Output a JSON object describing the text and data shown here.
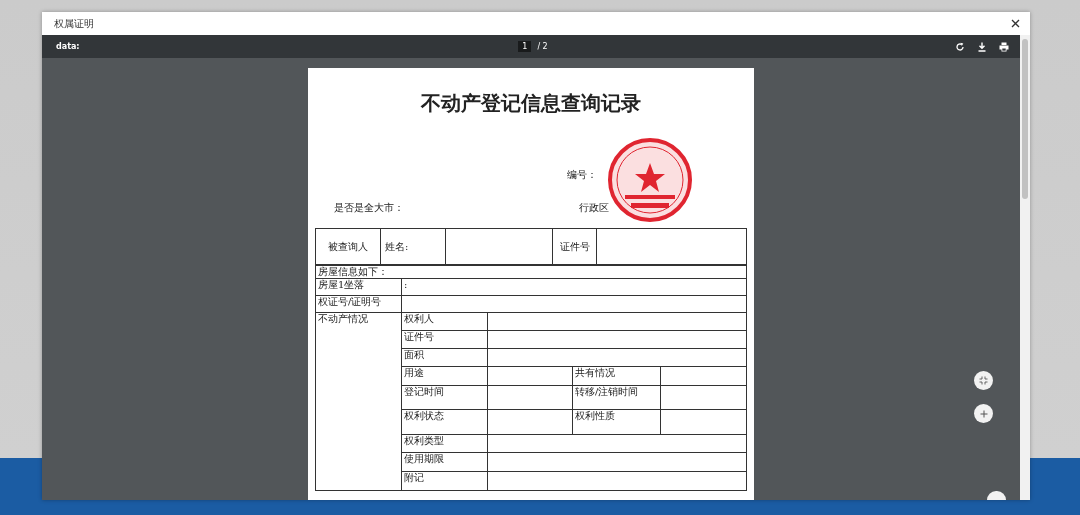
{
  "dialog": {
    "title": "权属证明"
  },
  "viewer_toolbar": {
    "file_name": "data:",
    "page": "1",
    "page_total": "/ 2"
  },
  "document": {
    "title": "不动产登记信息查询记录",
    "number_label": "编号：",
    "city_label": "是否是全大市：",
    "region_label": "行政区",
    "queried": {
      "label": "被查询人",
      "name_label": "姓名:",
      "id_label": "证件号"
    },
    "section_heading": "房屋信息如下：",
    "info_rows": [
      {
        "label": "房屋1坐落",
        "value": ":"
      },
      {
        "label": "权证号/证明号"
      }
    ],
    "property": {
      "label": "不动产情况",
      "rows": [
        {
          "kind": "single",
          "label": "权利人"
        },
        {
          "kind": "single",
          "label": "证件号"
        },
        {
          "kind": "single",
          "label": "面积"
        },
        {
          "kind": "pair",
          "label": "用途",
          "label_2": "共有情况"
        },
        {
          "kind": "pair",
          "label": "登记时间",
          "label_2": "转移/注销时间"
        },
        {
          "kind": "pair",
          "label": "权利状态",
          "label_2": "权利性质"
        },
        {
          "kind": "single",
          "label": "权利类型"
        },
        {
          "kind": "single",
          "label": "使用期限"
        },
        {
          "kind": "single",
          "label": "附记"
        }
      ]
    }
  }
}
